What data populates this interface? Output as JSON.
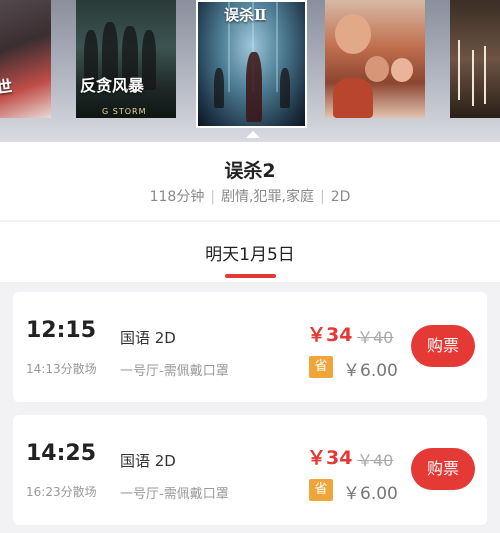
{
  "carousel": {
    "posters": [
      {
        "name": "poster-left-cut",
        "caption": "出世"
      },
      {
        "name": "poster-fanyfengbao",
        "caption": "反贪风暴",
        "sub": "G STORM"
      },
      {
        "name": "poster-selected",
        "caption": "误杀Ⅱ"
      },
      {
        "name": "poster-comedy",
        "caption": ""
      },
      {
        "name": "poster-right-cut",
        "caption": ""
      }
    ]
  },
  "movie": {
    "title": "误杀2",
    "duration": "118分钟",
    "genres": "剧情,犯罪,家庭",
    "format": "2D"
  },
  "date_tab": {
    "label": "明天1月5日"
  },
  "shows": [
    {
      "start": "12:15",
      "end": "14:13分散场",
      "lang": "国语 2D",
      "hall": "一号厅-需佩戴口罩",
      "price": "￥34",
      "original_price": "￥40",
      "save_label": "省",
      "save_amount": "￥6.00",
      "buy_label": "购票"
    },
    {
      "start": "14:25",
      "end": "16:23分散场",
      "lang": "国语 2D",
      "hall": "一号厅-需佩戴口罩",
      "price": "￥34",
      "original_price": "￥40",
      "save_label": "省",
      "save_amount": "￥6.00",
      "buy_label": "购票"
    }
  ],
  "colors": {
    "accent": "#e53935",
    "save_badge": "#f0a53b"
  }
}
